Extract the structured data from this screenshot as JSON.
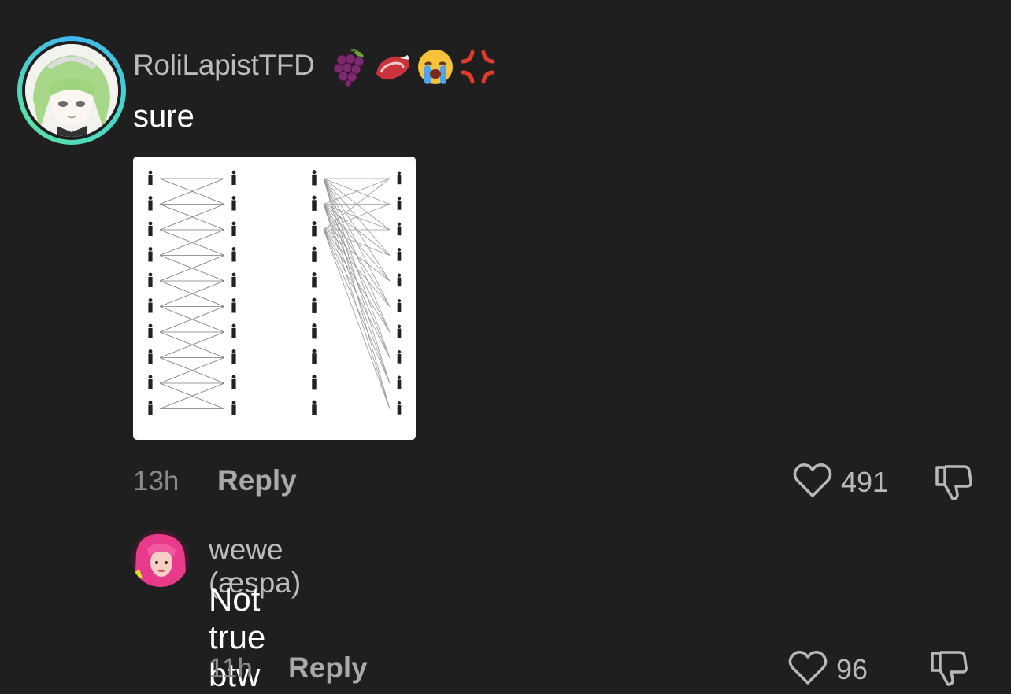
{
  "comments": [
    {
      "username": "RoliLapistTFD",
      "emojis": [
        "grapes-emoji",
        "meat-emoji",
        "crying-face-emoji",
        "anger-symbol-emoji"
      ],
      "text": "sure",
      "has_image": true,
      "time": "13h",
      "reply_label": "Reply",
      "likes": "491"
    },
    {
      "username": "wewe (æspa)",
      "text": "Not true btw",
      "time": "11h",
      "reply_label": "Reply",
      "likes": "96"
    }
  ],
  "colors": {
    "background": "#1f1f1f",
    "username": "#bcbcbc",
    "text": "#ffffff",
    "meta": "#8a8a8a",
    "ring": "#47d9c8"
  },
  "icons": {
    "like": "heart-outline-icon",
    "dislike": "thumbs-down-outline-icon"
  }
}
